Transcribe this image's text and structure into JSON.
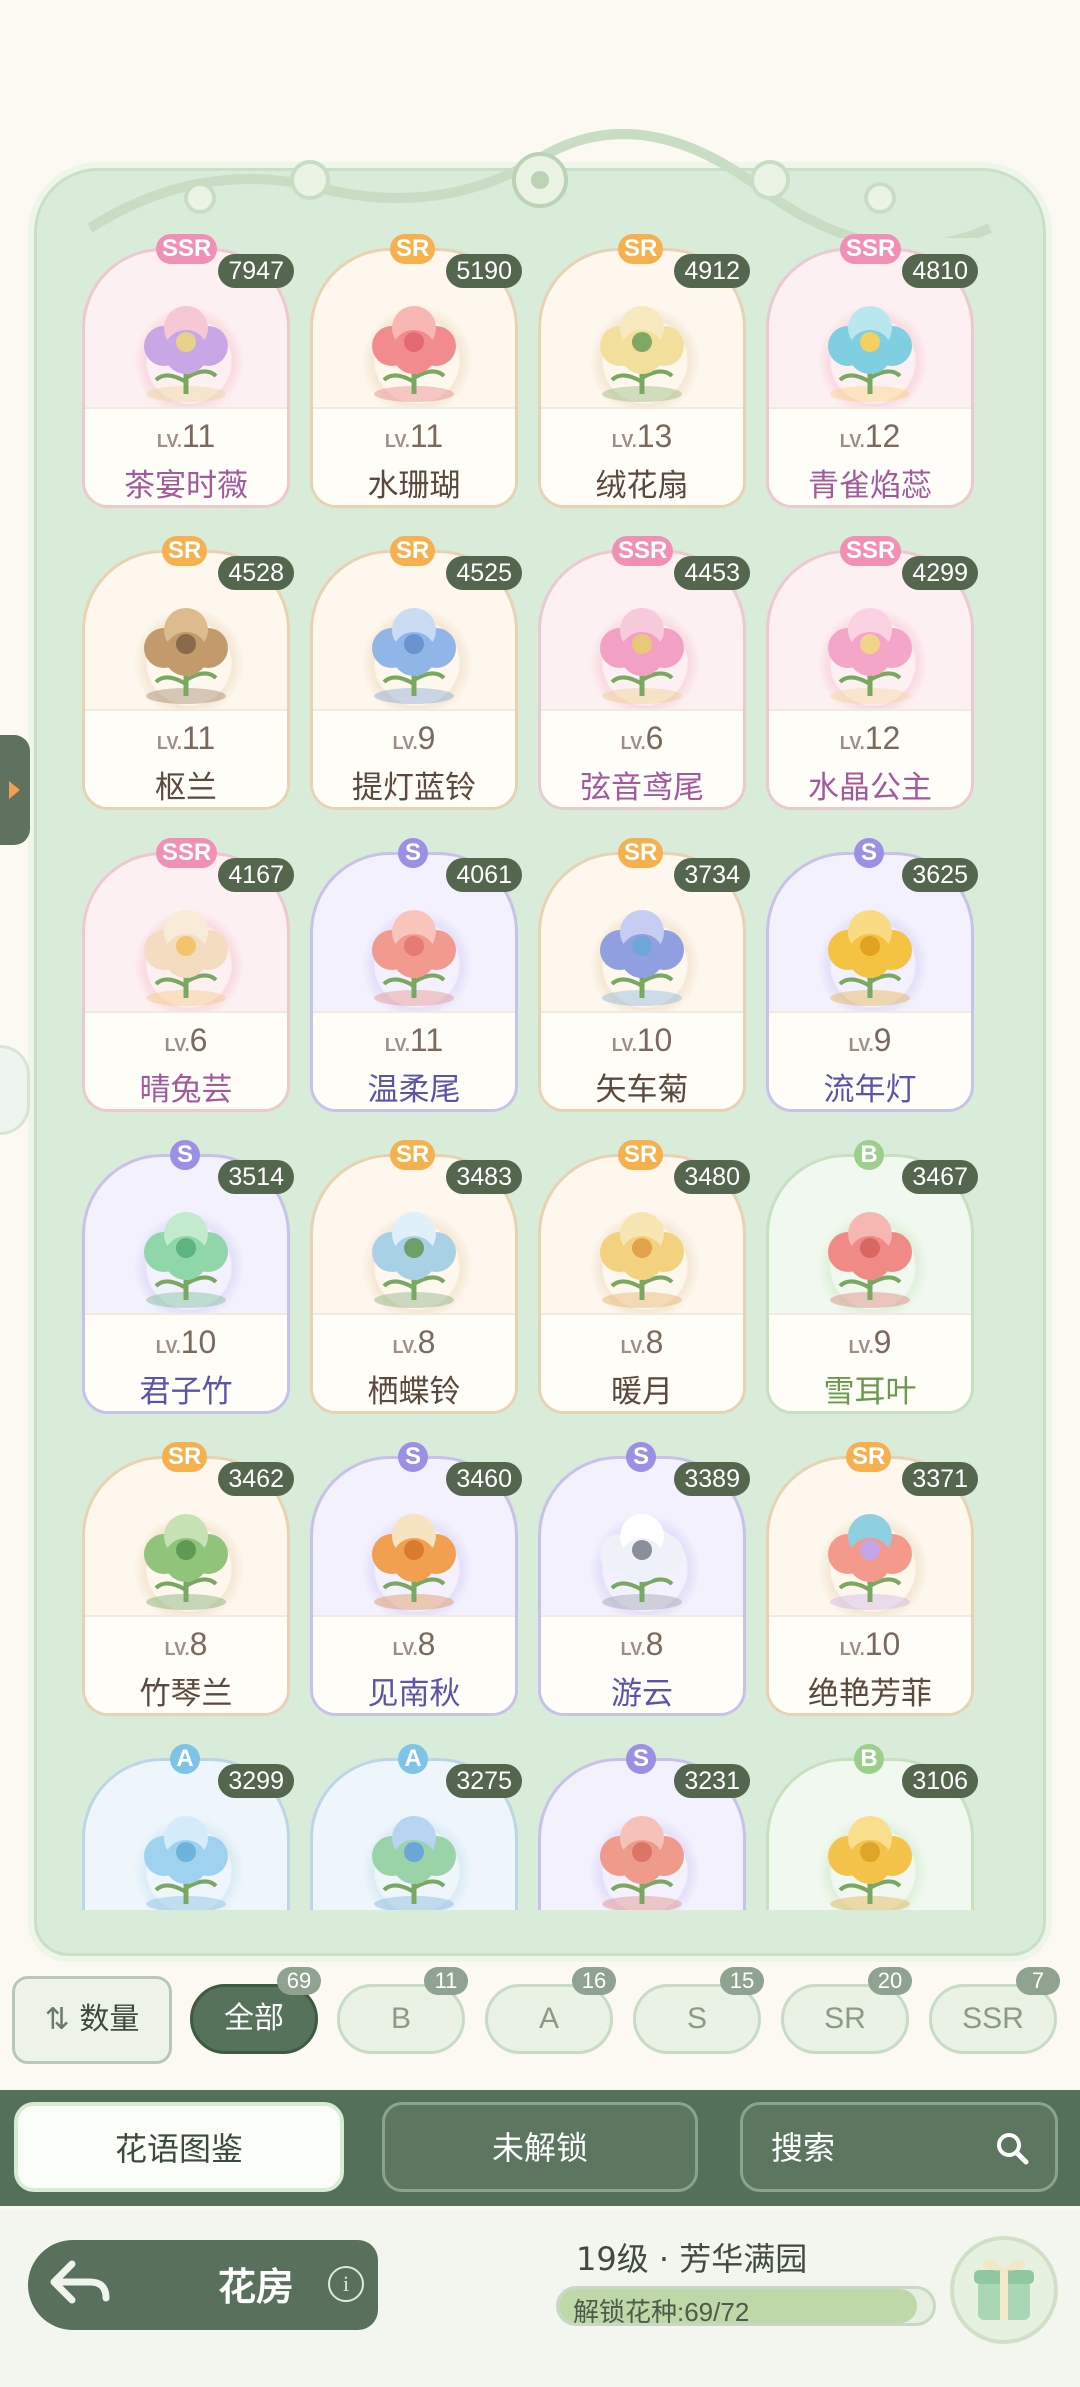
{
  "flowers": [
    {
      "rarity": "SSR",
      "count": "7947",
      "level": "11",
      "name": "茶宴时薇",
      "icon": "rose-teacup-flower-icon",
      "colors": [
        "#c9a7e6",
        "#f6c7d4",
        "#e6d08a"
      ]
    },
    {
      "rarity": "SR",
      "count": "5190",
      "level": "11",
      "name": "水珊瑚",
      "icon": "coral-flower-icon",
      "colors": [
        "#f28b8e",
        "#f9b7b3",
        "#e46a72"
      ]
    },
    {
      "rarity": "SR",
      "count": "4912",
      "level": "13",
      "name": "绒花扇",
      "icon": "fan-flower-icon",
      "colors": [
        "#f3df9c",
        "#f8eac0",
        "#7fa864"
      ]
    },
    {
      "rarity": "SSR",
      "count": "4810",
      "level": "12",
      "name": "青雀焰蕊",
      "icon": "peacock-flower-icon",
      "colors": [
        "#7fcfe0",
        "#b9e7ef",
        "#f5cf5f"
      ]
    },
    {
      "rarity": "SR",
      "count": "4528",
      "level": "11",
      "name": "枢兰",
      "icon": "orchid-icon",
      "colors": [
        "#c29a6c",
        "#dcbc8c",
        "#8a6a4a"
      ]
    },
    {
      "rarity": "SR",
      "count": "4525",
      "level": "9",
      "name": "提灯蓝铃",
      "icon": "bluebell-icon",
      "colors": [
        "#8fb6e6",
        "#c9dcf4",
        "#6a93cf"
      ]
    },
    {
      "rarity": "SSR",
      "count": "4453",
      "level": "6",
      "name": "弦音鸢尾",
      "icon": "iris-harp-icon",
      "colors": [
        "#f2a0c3",
        "#f7cadc",
        "#e9c878"
      ]
    },
    {
      "rarity": "SSR",
      "count": "4299",
      "level": "12",
      "name": "水晶公主",
      "icon": "crystal-princess-icon",
      "colors": [
        "#f3a6c8",
        "#fad2e2",
        "#f2d38a"
      ]
    },
    {
      "rarity": "SSR",
      "count": "4167",
      "level": "6",
      "name": "晴兔芸",
      "icon": "rabbit-flower-icon",
      "colors": [
        "#f3dcc0",
        "#f8ecd9",
        "#f4c46a"
      ]
    },
    {
      "rarity": "S",
      "count": "4061",
      "level": "11",
      "name": "温柔尾",
      "icon": "coral-fern-icon",
      "colors": [
        "#f29a8e",
        "#f8c4bb",
        "#e57b72"
      ]
    },
    {
      "rarity": "SR",
      "count": "3734",
      "level": "10",
      "name": "矢车菊",
      "icon": "cornflower-icon",
      "colors": [
        "#8f9fe0",
        "#c4cdf2",
        "#6fa6d6"
      ]
    },
    {
      "rarity": "S",
      "count": "3625",
      "level": "9",
      "name": "流年灯",
      "icon": "lantern-fruit-icon",
      "colors": [
        "#f4c342",
        "#f9dc82",
        "#e2a322"
      ]
    },
    {
      "rarity": "S",
      "count": "3514",
      "level": "10",
      "name": "君子竹",
      "icon": "bamboo-icon",
      "colors": [
        "#8fd6a8",
        "#c2ebcd",
        "#5cb37f"
      ]
    },
    {
      "rarity": "SR",
      "count": "3483",
      "level": "8",
      "name": "栖蝶铃",
      "icon": "butterfly-bell-icon",
      "colors": [
        "#a9d1e6",
        "#dff0f8",
        "#6e9f66"
      ]
    },
    {
      "rarity": "SR",
      "count": "3480",
      "level": "8",
      "name": "暖月",
      "icon": "moon-flower-icon",
      "colors": [
        "#f2d27e",
        "#f8e6b2",
        "#e0a24a"
      ]
    },
    {
      "rarity": "B",
      "count": "3467",
      "level": "9",
      "name": "雪耳叶",
      "icon": "red-leaf-icon",
      "colors": [
        "#ef8a86",
        "#f6b6b1",
        "#d96661"
      ]
    },
    {
      "rarity": "SR",
      "count": "3462",
      "level": "8",
      "name": "竹琴兰",
      "icon": "bamboo-orchid-icon",
      "colors": [
        "#8fc47a",
        "#c6e2b4",
        "#5f9a55"
      ]
    },
    {
      "rarity": "S",
      "count": "3460",
      "level": "8",
      "name": "见南秋",
      "icon": "pumpkin-flower-icon",
      "colors": [
        "#f0a04e",
        "#f6e3c0",
        "#d97a2e"
      ]
    },
    {
      "rarity": "S",
      "count": "3389",
      "level": "8",
      "name": "游云",
      "icon": "cloud-tree-icon",
      "colors": [
        "#eef1f7",
        "#ffffff",
        "#8a8f99"
      ]
    },
    {
      "rarity": "SR",
      "count": "3371",
      "level": "10",
      "name": "绝艳芳菲",
      "icon": "rainbow-rose-icon",
      "colors": [
        "#f49a8c",
        "#8fd0e0",
        "#c4a6e8"
      ]
    },
    {
      "rarity": "A",
      "count": "3299",
      "level": "",
      "name": "",
      "icon": "bubble-flower-icon",
      "colors": [
        "#9fd2ee",
        "#d4ecf9",
        "#6eb3dd"
      ]
    },
    {
      "rarity": "A",
      "count": "3275",
      "level": "",
      "name": "",
      "icon": "hydrangea-icon",
      "colors": [
        "#9ad3a8",
        "#b7d4f0",
        "#6aa7d8"
      ]
    },
    {
      "rarity": "S",
      "count": "3231",
      "level": "",
      "name": "",
      "icon": "carnation-icon",
      "colors": [
        "#ef9b8c",
        "#f6c2b8",
        "#dc7566"
      ]
    },
    {
      "rarity": "B",
      "count": "3106",
      "level": "",
      "name": "",
      "icon": "golden-peony-icon",
      "colors": [
        "#f4c44a",
        "#f9de8e",
        "#e0a428"
      ]
    }
  ],
  "level_prefix": "LV.",
  "filter": {
    "sort_label": "数量",
    "chips": [
      {
        "label": "全部",
        "count": "69",
        "active": true
      },
      {
        "label": "B",
        "count": "11",
        "active": false
      },
      {
        "label": "A",
        "count": "16",
        "active": false
      },
      {
        "label": "S",
        "count": "15",
        "active": false
      },
      {
        "label": "SR",
        "count": "20",
        "active": false
      },
      {
        "label": "SSR",
        "count": "7",
        "active": false
      }
    ]
  },
  "tabs": {
    "collection": "花语图鉴",
    "locked": "未解锁",
    "search": "搜索"
  },
  "footer": {
    "room_title": "花房",
    "info": "i",
    "garden_level": "19级 · 芳华满园",
    "unlock_text": "解锁花种:69/72",
    "unlock_progress": 0.9583
  },
  "colors": {
    "accent": "#56725a",
    "ssr": "#f28fb4",
    "sr": "#f6b04d",
    "s": "#9b8fe6",
    "a": "#7ec4e6",
    "b": "#9dcf8c"
  }
}
